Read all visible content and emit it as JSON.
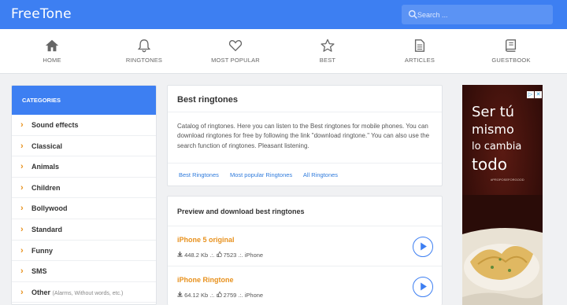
{
  "header": {
    "brand": "FreeTone",
    "search_placeholder": "Search ..."
  },
  "nav": [
    {
      "label": "HOME",
      "icon": "home-icon"
    },
    {
      "label": "RINGTONES",
      "icon": "bell-icon"
    },
    {
      "label": "MOST POPULAR",
      "icon": "heart-icon"
    },
    {
      "label": "BEST",
      "icon": "star-icon"
    },
    {
      "label": "ARTICLES",
      "icon": "document-icon"
    },
    {
      "label": "GUESTBOOK",
      "icon": "book-icon"
    }
  ],
  "sidebar": {
    "title": "CATEGORIES",
    "items": [
      {
        "label": "Sound effects"
      },
      {
        "label": "Classical"
      },
      {
        "label": "Animals"
      },
      {
        "label": "Children"
      },
      {
        "label": "Bollywood"
      },
      {
        "label": "Standard"
      },
      {
        "label": "Funny"
      },
      {
        "label": "SMS"
      },
      {
        "label": "Other",
        "sub": "(Alarms, Without words, etc.)"
      }
    ]
  },
  "intro": {
    "title": "Best ringtones",
    "text": "Catalog of ringtones. Here you can listen to the Best ringtones for mobile phones. You can download ringtones for free by following the link \"download ringtone.\" You can also use the search function of ringtones. Pleasant listening.",
    "links": [
      "Best Ringtones",
      "Most popular Ringtones",
      "All Ringtones"
    ]
  },
  "ringtones": {
    "title": "Preview and download best ringtones",
    "items": [
      {
        "name": "iPhone 5 original",
        "size": "448.2 Kb",
        "likes": "7523",
        "category": "iPhone"
      },
      {
        "name": "iPhone Ringtone",
        "size": "64.12 Kb",
        "likes": "2759",
        "category": "iPhone"
      }
    ]
  },
  "ad": {
    "line1": "Ser tú",
    "line2": "mismo",
    "line3": "lo cambia",
    "line4": "todo",
    "small": "#PROPOSEFORGOOD"
  },
  "colors": {
    "accent": "#3d7ff2",
    "orange": "#e8911d",
    "link": "#2f7bdc"
  }
}
